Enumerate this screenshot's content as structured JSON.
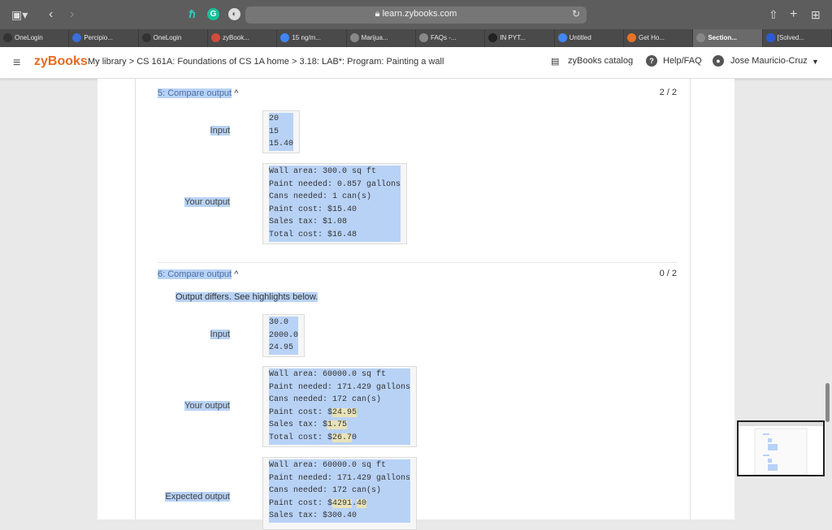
{
  "browser": {
    "url": "learn.zybooks.com",
    "tabs": [
      {
        "label": "OneLogin",
        "icon_color": "#333333"
      },
      {
        "label": "Percipio...",
        "icon_color": "#3a6fd8"
      },
      {
        "label": "OneLogin",
        "icon_color": "#333333"
      },
      {
        "label": "zyBook...",
        "icon_color": "#d24c3c"
      },
      {
        "label": "15 ng/m...",
        "icon_color": "#4285f4"
      },
      {
        "label": "Marijua...",
        "icon_color": "#888888"
      },
      {
        "label": "FAQs -...",
        "icon_color": "#888888"
      },
      {
        "label": "IN PYT...",
        "icon_color": "#222222"
      },
      {
        "label": "Untitled",
        "icon_color": "#4285f4"
      },
      {
        "label": "Get Ho...",
        "icon_color": "#e8722a"
      },
      {
        "label": "Section...",
        "icon_color": "#888888"
      },
      {
        "label": "[Solved...",
        "icon_color": "#2a5bd7"
      }
    ]
  },
  "header": {
    "logo": "zyBooks",
    "breadcrumb": "My library > CS 161A: Foundations of CS 1A home > 3.18: LAB*: Program: Painting a wall",
    "catalog": "zyBooks catalog",
    "help": "Help/FAQ",
    "user": "Jose Mauricio-Cruz"
  },
  "test5": {
    "title": "5: Compare output",
    "score": "2 / 2",
    "input_label": "Input",
    "input": [
      "20",
      "15",
      "15.40"
    ],
    "output_label": "Your output",
    "output": [
      "Wall area: 300.0 sq ft",
      "Paint needed: 0.857 gallons",
      "Cans needed: 1 can(s)",
      "Paint cost: $15.40",
      "Sales tax: $1.08",
      "Total cost: $16.48"
    ]
  },
  "test6": {
    "title": "6: Compare output",
    "score": "0 / 2",
    "differs": "Output differs. See highlights below.",
    "input_label": "Input",
    "input": [
      "30.0",
      "2000.0",
      "24.95"
    ],
    "output_label": "Your output",
    "output": [
      "Wall area: 60000.0 sq ft",
      "Paint needed: 171.429 gallons",
      "Cans needed: 172 can(s)"
    ],
    "out_cost": {
      "a": "Paint cost: $",
      "b": "24.95",
      "c": ""
    },
    "out_tax": {
      "a": "Sales tax: $",
      "b": "1.75",
      "c": ""
    },
    "out_total": {
      "a": "Total cost: $",
      "b": "26.7",
      "c": "0"
    },
    "expected_label": "Expected output",
    "expected": [
      "Wall area: 60000.0 sq ft",
      "Paint needed: 171.429 gallons",
      "Cans needed: 172 can(s)"
    ],
    "exp_cost": {
      "a": "Paint cost: $",
      "b": "4291",
      "c": ".",
      "d": "40"
    },
    "exp_tax": "Sales tax: $300.40"
  }
}
